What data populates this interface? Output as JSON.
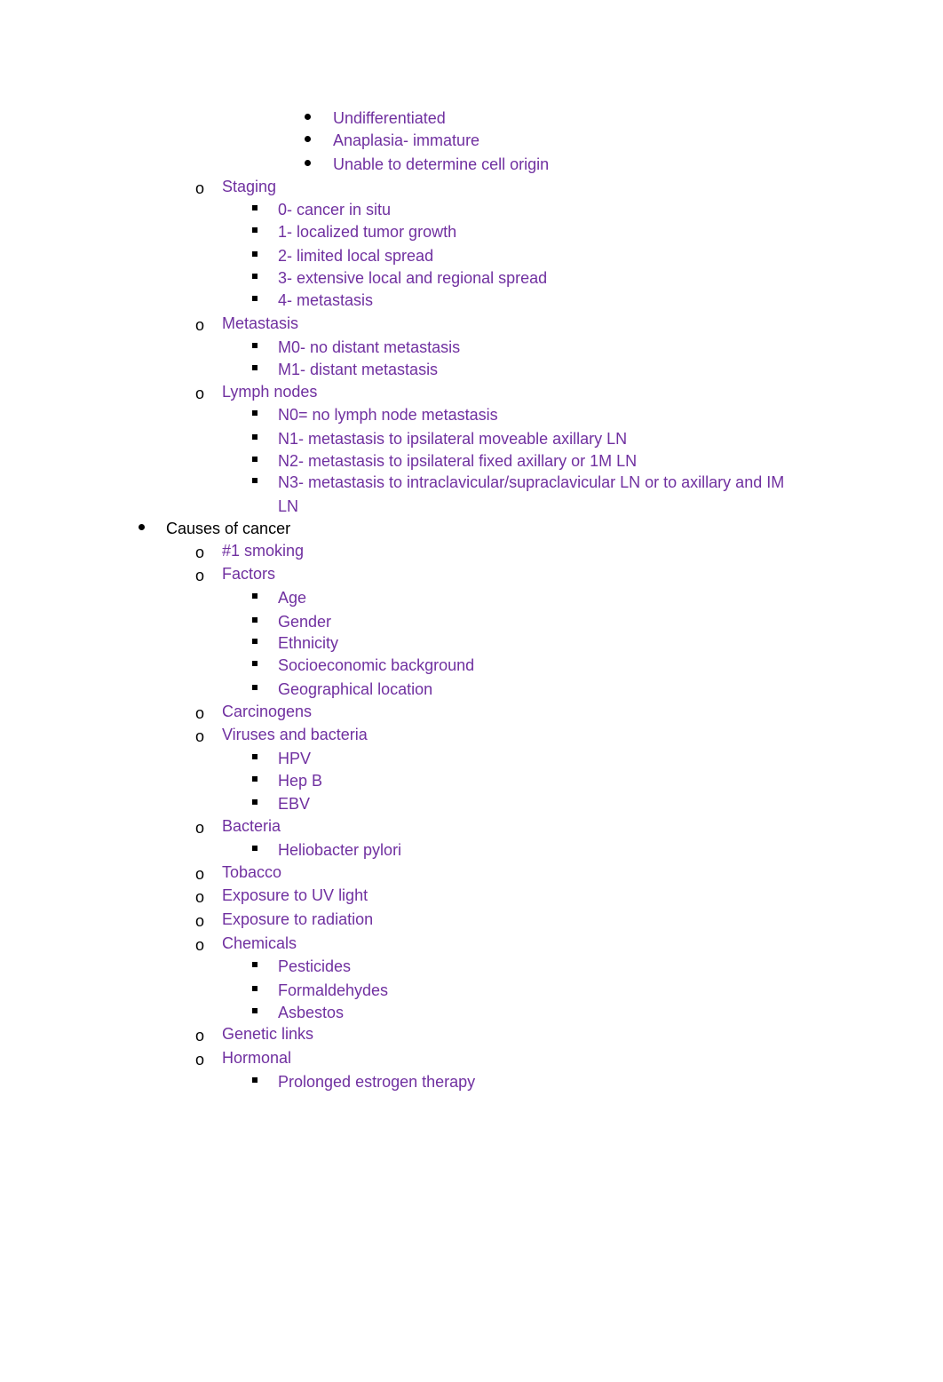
{
  "document": {
    "colors": {
      "text_accent": "#7030a0",
      "text_default": "#000000"
    },
    "differentiation_items": [
      "Undifferentiated",
      "Anaplasia- immature",
      "Unable to determine cell origin"
    ],
    "staging": {
      "label": "Staging",
      "items": [
        "0- cancer in situ",
        "1- localized tumor growth",
        "2- limited local spread",
        "3- extensive local and regional spread",
        "4- metastasis"
      ]
    },
    "metastasis": {
      "label": "Metastasis",
      "items": [
        "M0- no distant metastasis",
        "M1- distant metastasis"
      ]
    },
    "lymph_nodes": {
      "label": "Lymph nodes",
      "items": [
        "N0= no lymph node metastasis",
        "N1- metastasis to ipsilateral moveable axillary LN",
        "N2- metastasis to ipsilateral fixed axillary or 1M LN",
        "N3- metastasis to intraclavicular/supraclavicular LN or to axillary and IM",
        "LN"
      ]
    },
    "causes": {
      "label": "Causes of cancer",
      "smoking": "#1 smoking",
      "factors": {
        "label": "Factors",
        "items": [
          "Age",
          "Gender",
          "Ethnicity",
          "Socioeconomic background",
          "Geographical location"
        ]
      },
      "carcinogens": "Carcinogens",
      "viruses": {
        "label": "Viruses and bacteria",
        "items": [
          "HPV",
          "Hep B",
          "EBV"
        ]
      },
      "bacteria": {
        "label": "Bacteria",
        "items": [
          "Heliobacter pylori"
        ]
      },
      "tobacco": "Tobacco",
      "uv": "Exposure to UV light",
      "radiation": "Exposure to radiation",
      "chemicals": {
        "label": "Chemicals",
        "items": [
          "Pesticides",
          "Formaldehydes",
          "Asbestos"
        ]
      },
      "genetic": "Genetic links",
      "hormonal": {
        "label": "Hormonal",
        "items": [
          "Prolonged estrogen therapy"
        ]
      }
    }
  }
}
